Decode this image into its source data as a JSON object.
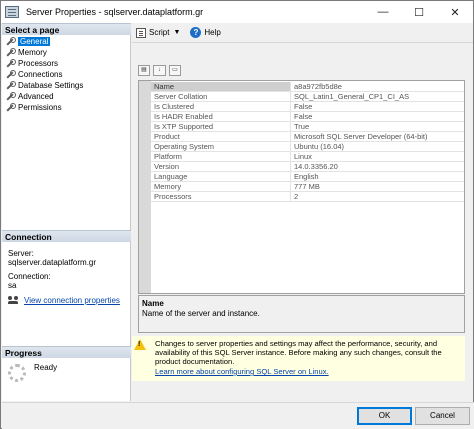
{
  "window": {
    "title": "Server Properties - sqlserver.dataplatform.gr",
    "minimize": "—",
    "maximize": "☐",
    "close": "✕"
  },
  "left": {
    "select_page_header": "Select a page",
    "pages": [
      {
        "label": "General",
        "selected": true
      },
      {
        "label": "Memory",
        "selected": false
      },
      {
        "label": "Processors",
        "selected": false
      },
      {
        "label": "Connections",
        "selected": false
      },
      {
        "label": "Database Settings",
        "selected": false
      },
      {
        "label": "Advanced",
        "selected": false
      },
      {
        "label": "Permissions",
        "selected": false
      }
    ],
    "connection_header": "Connection",
    "server_label": "Server:",
    "server_value": "sqlserver.dataplatform.gr",
    "connection_label": "Connection:",
    "connection_value": "sa",
    "view_connection_link": "View connection properties",
    "progress_header": "Progress",
    "progress_status": "Ready"
  },
  "toolbar": {
    "script_label": "Script",
    "help_label": "Help"
  },
  "properties": [
    {
      "name": "Name",
      "value": "a8a972fb5d8e"
    },
    {
      "name": "Server Collation",
      "value": "SQL_Latin1_General_CP1_CI_AS"
    },
    {
      "name": "Is Clustered",
      "value": "False"
    },
    {
      "name": "Is HADR Enabled",
      "value": "False"
    },
    {
      "name": "Is XTP Supported",
      "value": "True"
    },
    {
      "name": "Product",
      "value": "Microsoft SQL Server Developer (64-bit)"
    },
    {
      "name": "Operating System",
      "value": "Ubuntu (16.04)"
    },
    {
      "name": "Platform",
      "value": "Linux"
    },
    {
      "name": "Version",
      "value": "14.0.3356.20"
    },
    {
      "name": "Language",
      "value": "English"
    },
    {
      "name": "Memory",
      "value": "777 MB"
    },
    {
      "name": "Processors",
      "value": "2"
    }
  ],
  "description": {
    "title": "Name",
    "text": "Name of the server and instance."
  },
  "warning": {
    "text": "Changes to server properties and settings may affect the performance, security, and availability of this SQL Server instance. Before making any such changes, consult the product documentation.",
    "link": "Learn more about configuring SQL Server on Linux."
  },
  "buttons": {
    "ok": "OK",
    "cancel": "Cancel"
  },
  "colors": {
    "selection": "#0078d7",
    "warning_bg": "#ffffe1"
  }
}
